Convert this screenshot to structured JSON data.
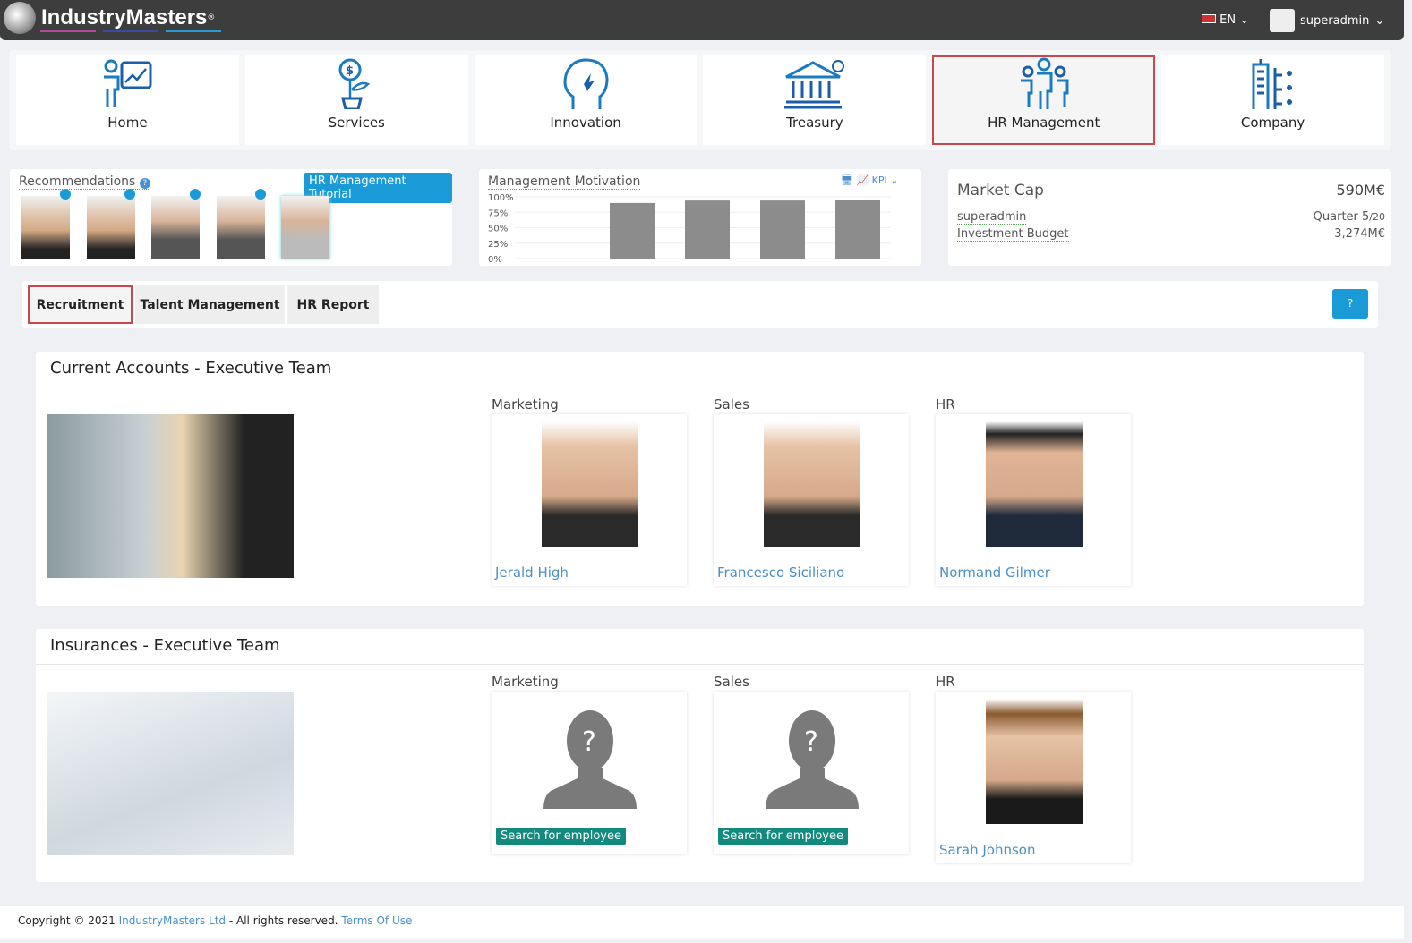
{
  "header": {
    "brand": "IndustryMasters",
    "registered": "®",
    "brand_colors": [
      "#b04a9a",
      "#3a4aa0",
      "#2a9ad6"
    ],
    "language": "EN",
    "user": "superadmin"
  },
  "nav": [
    {
      "label": "Home",
      "icon": "presenter-chart-icon"
    },
    {
      "label": "Services",
      "icon": "money-plant-icon"
    },
    {
      "label": "Innovation",
      "icon": "head-idea-icon"
    },
    {
      "label": "Treasury",
      "icon": "bank-icon"
    },
    {
      "label": "HR Management",
      "icon": "people-icon",
      "active": true
    },
    {
      "label": "Company",
      "icon": "buildings-icon"
    }
  ],
  "recommendations": {
    "title": "Recommendations",
    "tutorial": "HR Management Tutorial",
    "count": 5
  },
  "motivation": {
    "title": "Management Motivation",
    "kpi": "KPI",
    "chart_data": {
      "type": "bar",
      "title": "Management Motivation",
      "yticks": [
        "100%",
        "75%",
        "50%",
        "25%",
        "0%"
      ],
      "ylim": [
        0,
        100
      ],
      "values": [
        90,
        94,
        94,
        95
      ],
      "color": "#8c8c8c",
      "grid": true
    }
  },
  "market": {
    "title": "Market Cap",
    "value": "590M€",
    "user": "superadmin",
    "quarter": "Quarter 5",
    "quarter_total": "/20",
    "budget_label": "Investment Budget",
    "budget": "3,274M€"
  },
  "tabs": [
    {
      "label": "Recruitment",
      "active": true
    },
    {
      "label": "Talent Management"
    },
    {
      "label": "HR Report"
    }
  ],
  "help": "?",
  "sections": [
    {
      "title": "Current Accounts - Executive Team",
      "members": [
        {
          "role": "Marketing",
          "name": "Jerald High"
        },
        {
          "role": "Sales",
          "name": "Francesco Siciliano"
        },
        {
          "role": "HR",
          "name": "Normand Gilmer"
        }
      ]
    },
    {
      "title": "Insurances - Executive Team",
      "members": [
        {
          "role": "Marketing",
          "name": "",
          "action": "Search for employee"
        },
        {
          "role": "Sales",
          "name": "",
          "action": "Search for employee"
        },
        {
          "role": "HR",
          "name": "Sarah Johnson"
        }
      ]
    }
  ],
  "footer": {
    "copyright": "Copyright © 2021 ",
    "company": "IndustryMasters Ltd",
    "rights": " - All rights reserved. ",
    "terms": "Terms Of Use"
  }
}
